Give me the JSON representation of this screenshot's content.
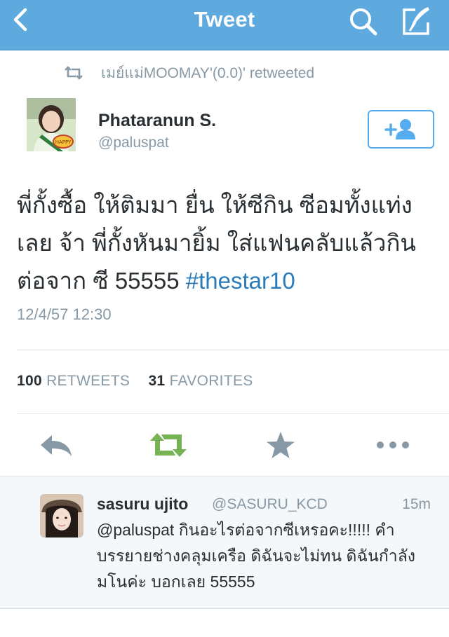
{
  "header": {
    "title": "Tweet"
  },
  "retweet_context": {
    "text": "เมย์แม่MOOMAY'(0.0)' retweeted"
  },
  "tweet": {
    "author_name": "Phataranun S.",
    "author_handle": "@paluspat",
    "text_main": "พี่กั้งซื้อ ให้ติมมา ยื่น ให้ซีกิน ซีอมทั้งแท่งเลย จ้า พี่กั้งหันมายิ้ม ใส่แฟนคลับแล้วกินต่อจาก ซี 55555 ",
    "hashtag": "#thestar10",
    "timestamp": "12/4/57 12:30",
    "retweets_count": "100",
    "retweets_label": "RETWEETS",
    "favorites_count": "31",
    "favorites_label": "FAVORITES"
  },
  "reply": {
    "name": "sasuru ujito",
    "handle": "@SASURU_KCD",
    "time": "15m",
    "text": "@paluspat กินอะไรต่อจากซีเหรอคะ!!!!! คำบรรยายช่างคลุมเครือ ดิฉันจะไม่ทน ดิฉันกำลังมโนค่ะ บอกเลย 55555"
  },
  "colors": {
    "navbar": "#5ea9dd",
    "retweet_green": "#77b255",
    "link_blue": "#2b7bb9",
    "muted_gray": "#8899a6"
  },
  "icons": [
    "back-icon",
    "search-icon",
    "compose-icon",
    "retweet-icon",
    "follow-icon",
    "reply-icon",
    "star-icon",
    "more-icon"
  ]
}
